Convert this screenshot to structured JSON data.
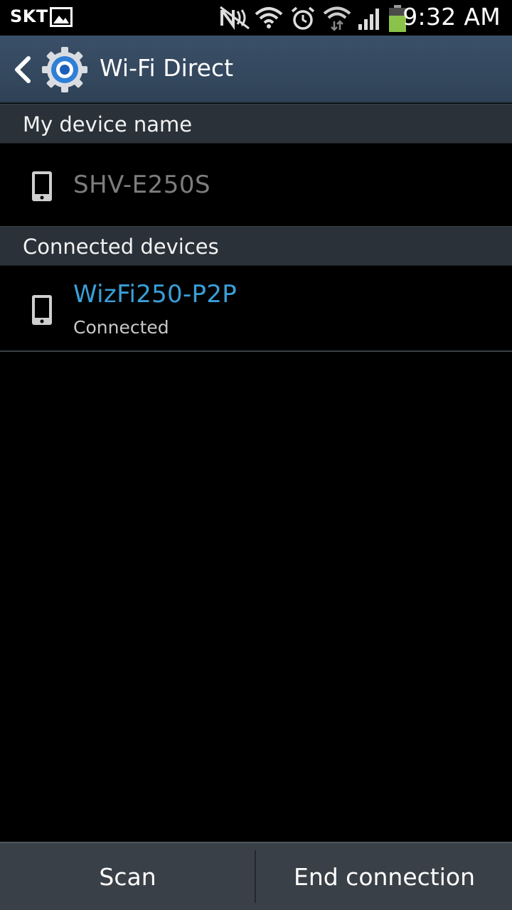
{
  "status_bar": {
    "carrier": "SKT",
    "time": "9:32 AM",
    "icons": [
      "gallery-icon",
      "nfc-icon",
      "wifi-icon",
      "alarm-icon",
      "wifi-transfer-icon",
      "signal-icon",
      "battery-icon"
    ]
  },
  "action_bar": {
    "title": "Wi-Fi Direct",
    "icon": "settings-gear-icon"
  },
  "my_device": {
    "header": "My device name",
    "name": "SHV-E250S"
  },
  "connected_devices": {
    "header": "Connected devices",
    "items": [
      {
        "name": "WizFi250-P2P",
        "status": "Connected"
      }
    ]
  },
  "buttons": {
    "scan": "Scan",
    "end_connection": "End connection"
  },
  "colors": {
    "accent": "#3a9fd8",
    "action_bar": "#344a60",
    "section_header": "#2a3138",
    "battery": "#8bc34a"
  }
}
